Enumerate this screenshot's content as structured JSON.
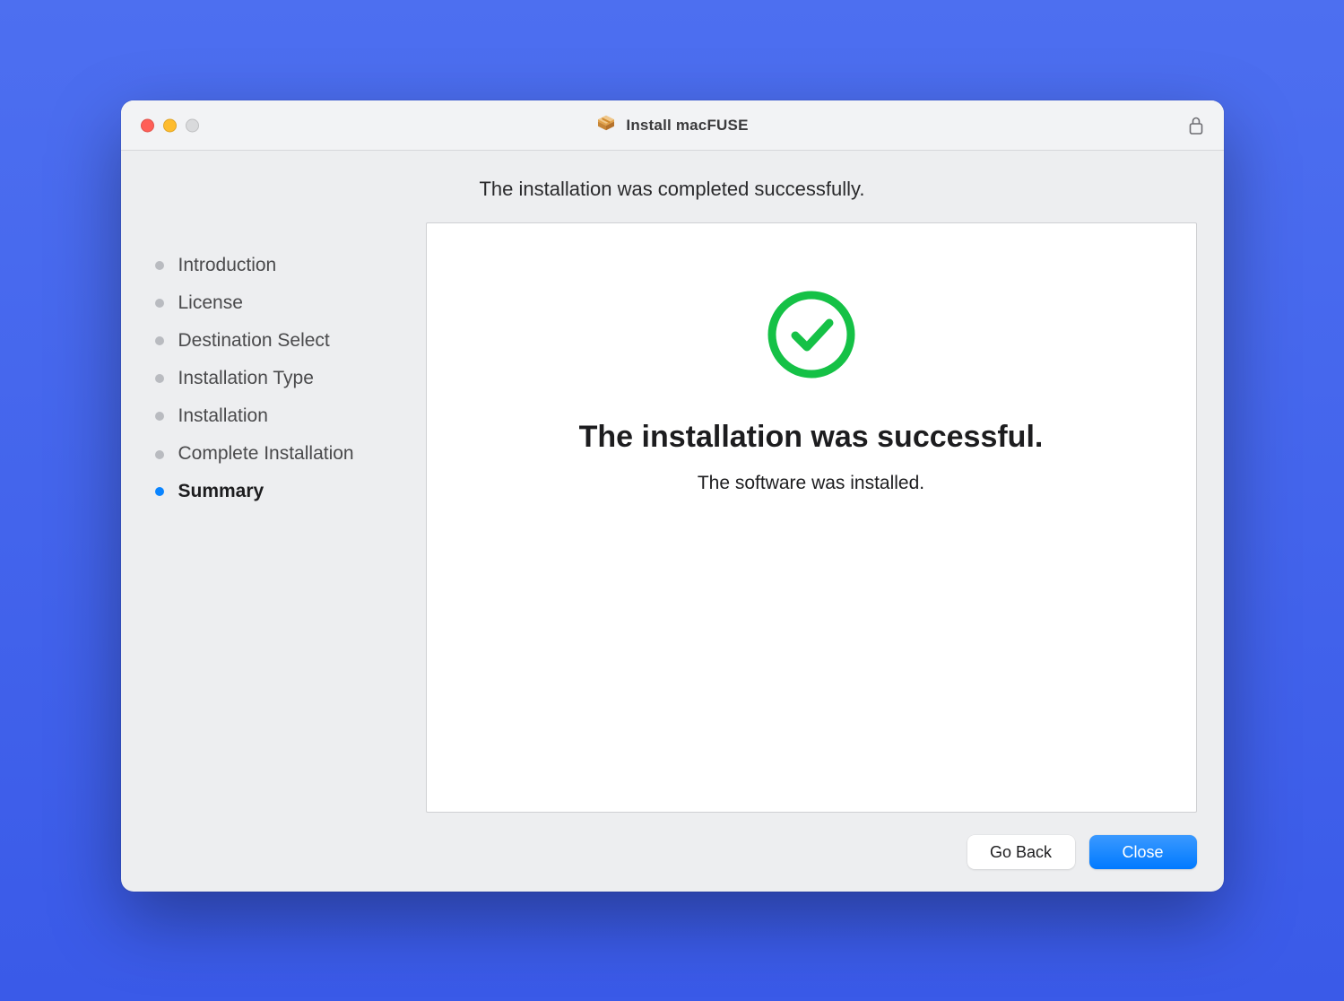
{
  "window": {
    "title": "Install macFUSE"
  },
  "header": {
    "text": "The installation was completed successfully."
  },
  "sidebar": {
    "steps": [
      {
        "label": "Introduction",
        "active": false
      },
      {
        "label": "License",
        "active": false
      },
      {
        "label": "Destination Select",
        "active": false
      },
      {
        "label": "Installation Type",
        "active": false
      },
      {
        "label": "Installation",
        "active": false
      },
      {
        "label": "Complete Installation",
        "active": false
      },
      {
        "label": "Summary",
        "active": true
      }
    ]
  },
  "main": {
    "title": "The installation was successful.",
    "subtitle": "The software was installed."
  },
  "footer": {
    "back_label": "Go Back",
    "close_label": "Close"
  },
  "colors": {
    "accent": "#007aff",
    "success": "#15c146"
  }
}
